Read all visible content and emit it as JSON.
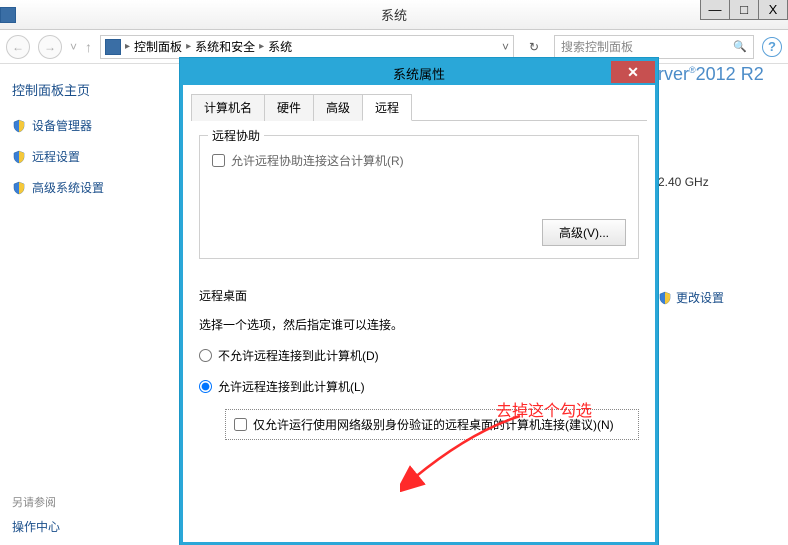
{
  "window": {
    "title": "系统",
    "min_glyph": "—",
    "max_glyph": "□",
    "close_glyph": "X"
  },
  "nav": {
    "back_glyph": "←",
    "fwd_glyph": "→",
    "up_glyph": "˅",
    "breadcrumb": [
      "控制面板",
      "系统和安全",
      "系统"
    ],
    "sep": "▸",
    "dropdown_glyph": "˅",
    "refresh_glyph": "↻",
    "search_placeholder": "搜索控制面板",
    "search_glyph": "🔍",
    "help_glyph": "?"
  },
  "sidebar": {
    "title": "控制面板主页",
    "links": [
      {
        "label": "设备管理器"
      },
      {
        "label": "远程设置"
      },
      {
        "label": "高级系统设置"
      }
    ],
    "footer_muted": "另请参阅",
    "footer_link": "操作中心"
  },
  "dialog": {
    "title": "系统属性",
    "close_glyph": "✕",
    "tabs": [
      "计算机名",
      "硬件",
      "高级",
      "远程"
    ],
    "active_tab_index": 3,
    "remote_assist": {
      "legend": "远程协助",
      "checkbox_label": "允许远程协助连接这台计算机(R)",
      "checked": false,
      "advanced_btn": "高级(V)..."
    },
    "remote_desktop": {
      "legend": "远程桌面",
      "para": "选择一个选项，然后指定谁可以连接。",
      "radio_disallow": "不允许远程连接到此计算机(D)",
      "radio_allow": "允许远程连接到此计算机(L)",
      "selected": "allow",
      "nla_checkbox": "仅允许运行使用网络级别身份验证的远程桌面的计算机连接(建议)(N)",
      "nla_checked": false
    }
  },
  "right_peek": {
    "brand_part1": "rver",
    "brand_part2": "2012",
    "brand_part3": "R2",
    "cpu": "2.40 GHz",
    "change_link": "更改设置",
    "reg_mark": "®"
  },
  "annotation": {
    "text": "去掉这个勾选"
  }
}
